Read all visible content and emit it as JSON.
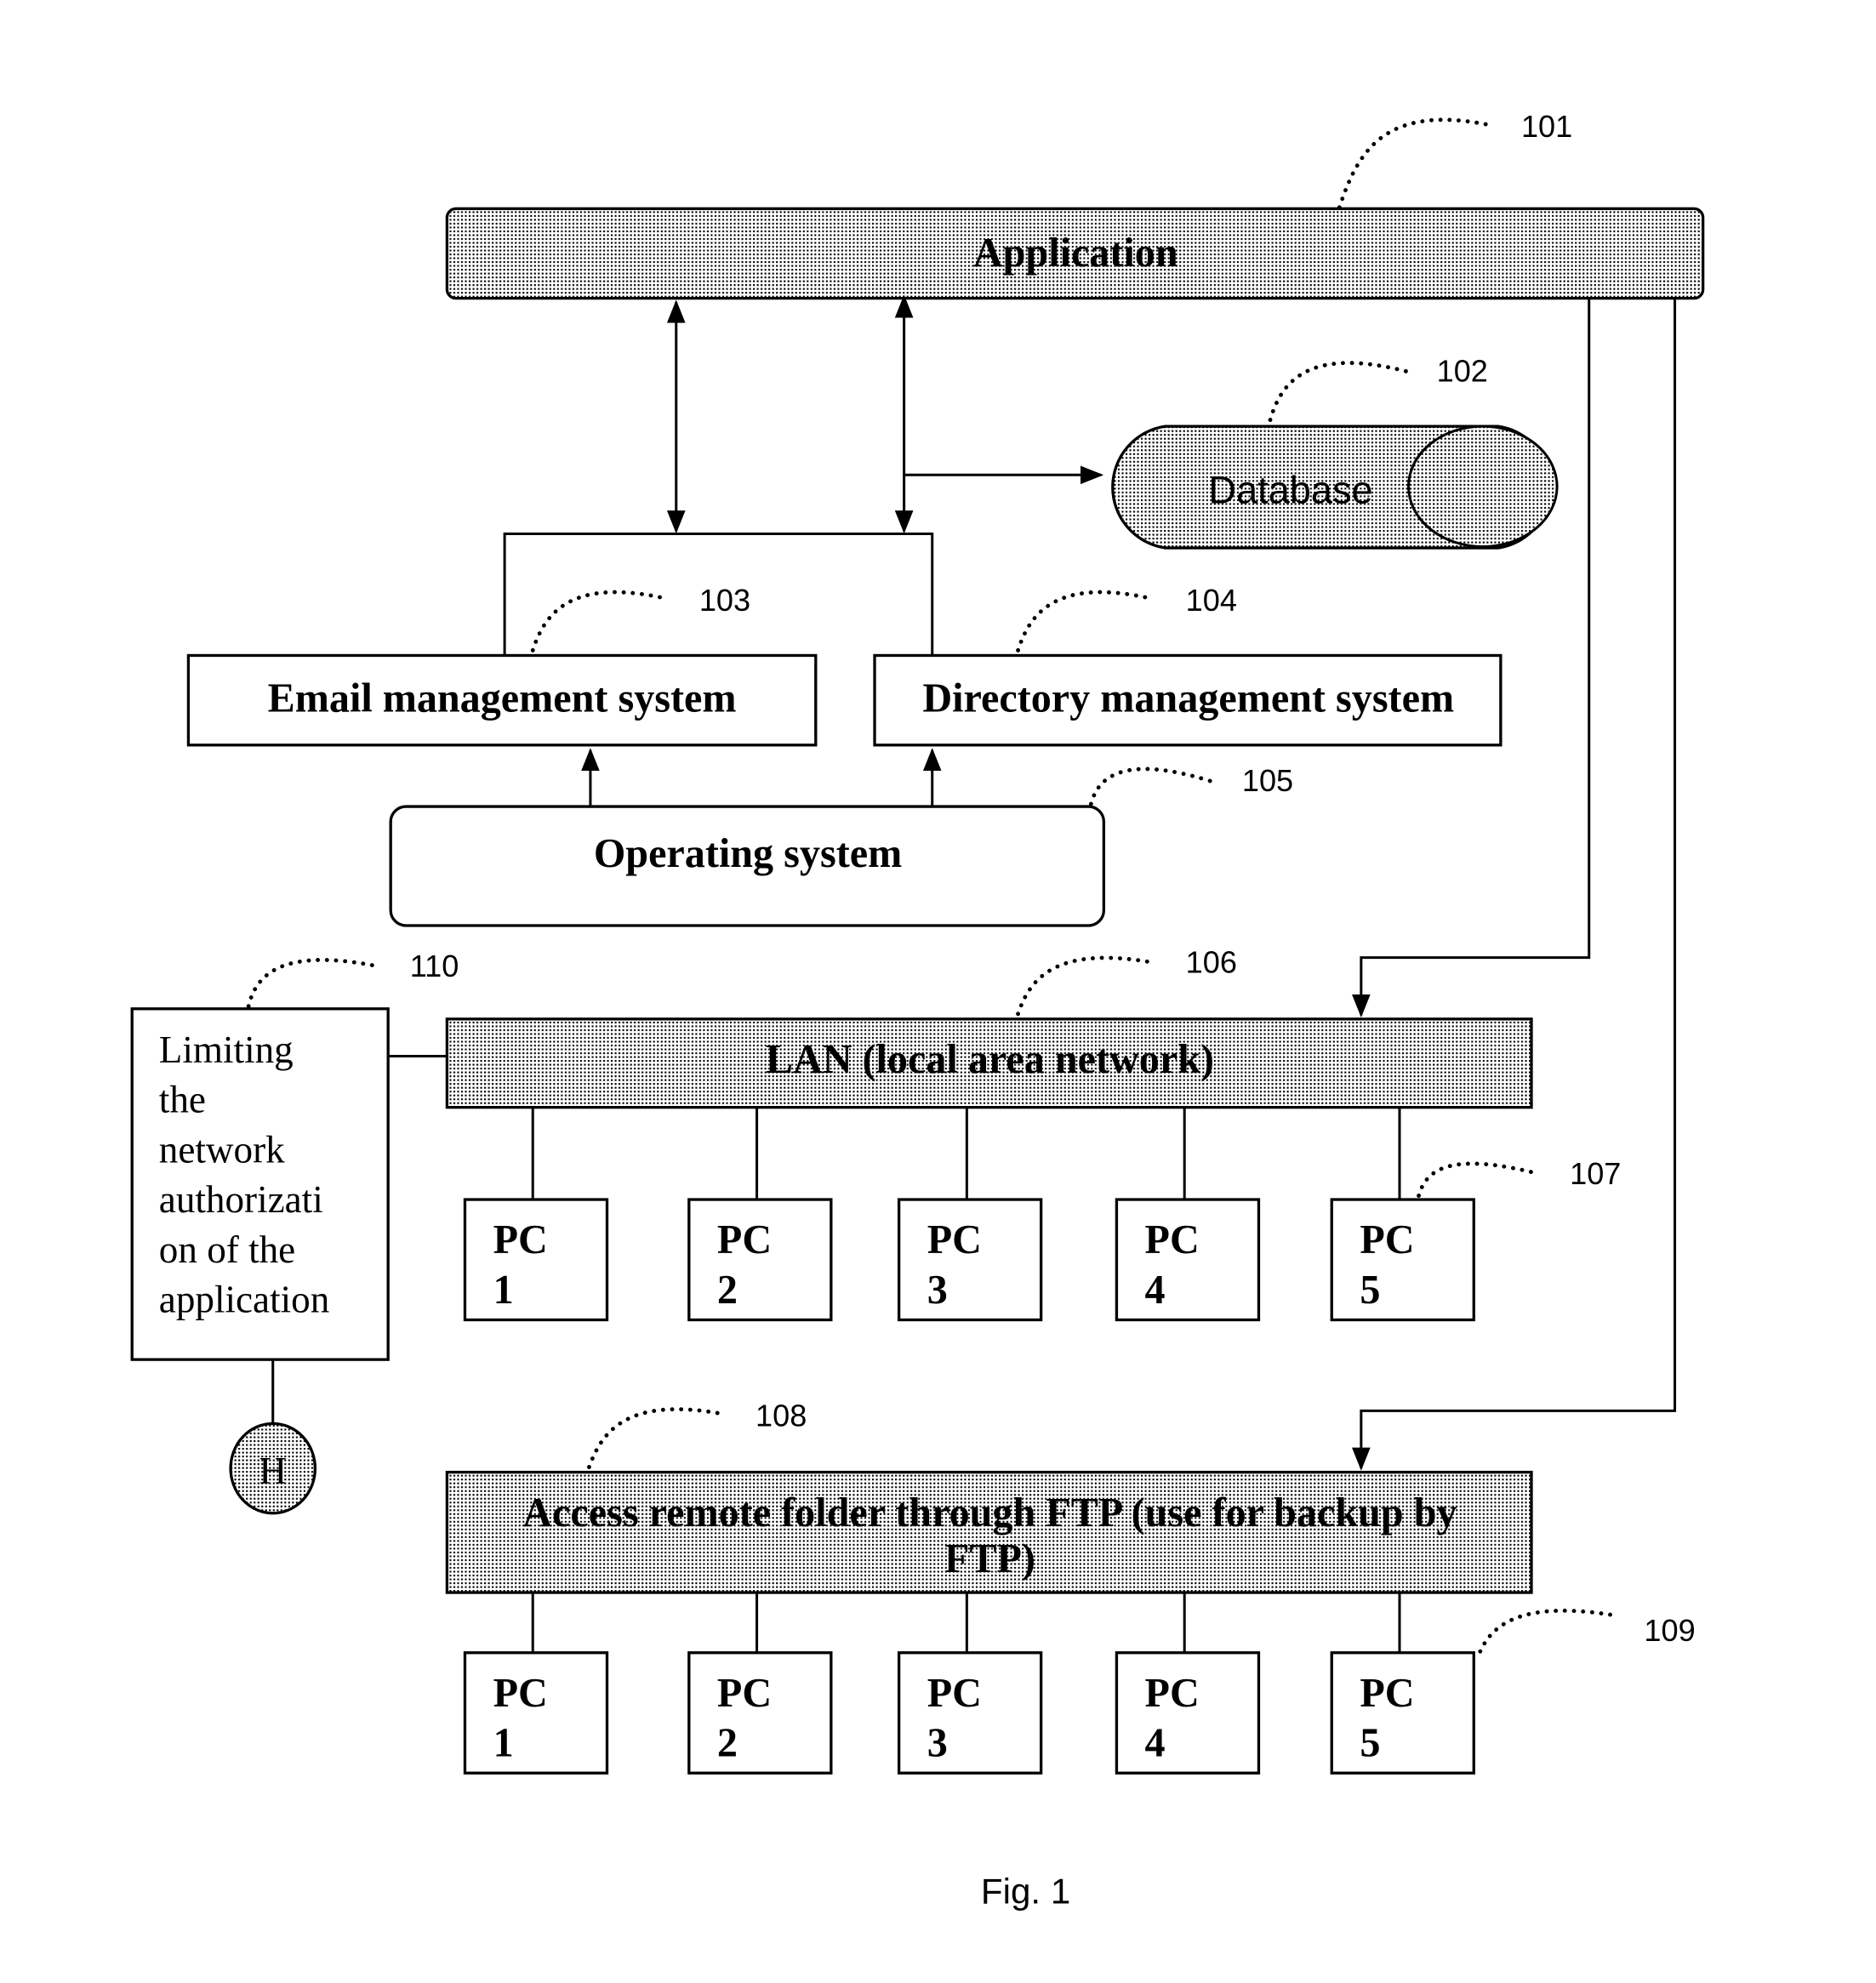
{
  "figure": {
    "caption": "Fig. 1",
    "colors": {
      "line": "#000000",
      "background": "#ffffff",
      "hatch": "#000000"
    }
  },
  "blocks": {
    "application": {
      "label": "Application",
      "ref": "101"
    },
    "database": {
      "label": "Database",
      "ref": "102"
    },
    "email": {
      "label": "Email management system",
      "ref": "103"
    },
    "directory": {
      "label": "Directory management system",
      "ref": "104"
    },
    "os": {
      "label": "Operating system",
      "ref": "105"
    },
    "lan": {
      "label": "LAN (local area network)",
      "ref": "106",
      "pc_ref": "107"
    },
    "ftp": {
      "label_line1": "Access remote folder through FTP (use for backup by",
      "label_line2": "FTP)",
      "ref": "108",
      "pc_ref": "109"
    },
    "limit": {
      "lines": [
        "Limiting",
        "the",
        "network",
        "authorizati",
        "on of the",
        "application"
      ],
      "ref": "110"
    },
    "hub": {
      "label": "H"
    }
  },
  "lan_pcs": [
    {
      "line1": "PC",
      "line2": "1"
    },
    {
      "line1": "PC",
      "line2": "2"
    },
    {
      "line1": "PC",
      "line2": "3"
    },
    {
      "line1": "PC",
      "line2": "4"
    },
    {
      "line1": "PC",
      "line2": "5"
    }
  ],
  "ftp_pcs": [
    {
      "line1": "PC",
      "line2": "1"
    },
    {
      "line1": "PC",
      "line2": "2"
    },
    {
      "line1": "PC",
      "line2": "3"
    },
    {
      "line1": "PC",
      "line2": "4"
    },
    {
      "line1": "PC",
      "line2": "5"
    }
  ]
}
